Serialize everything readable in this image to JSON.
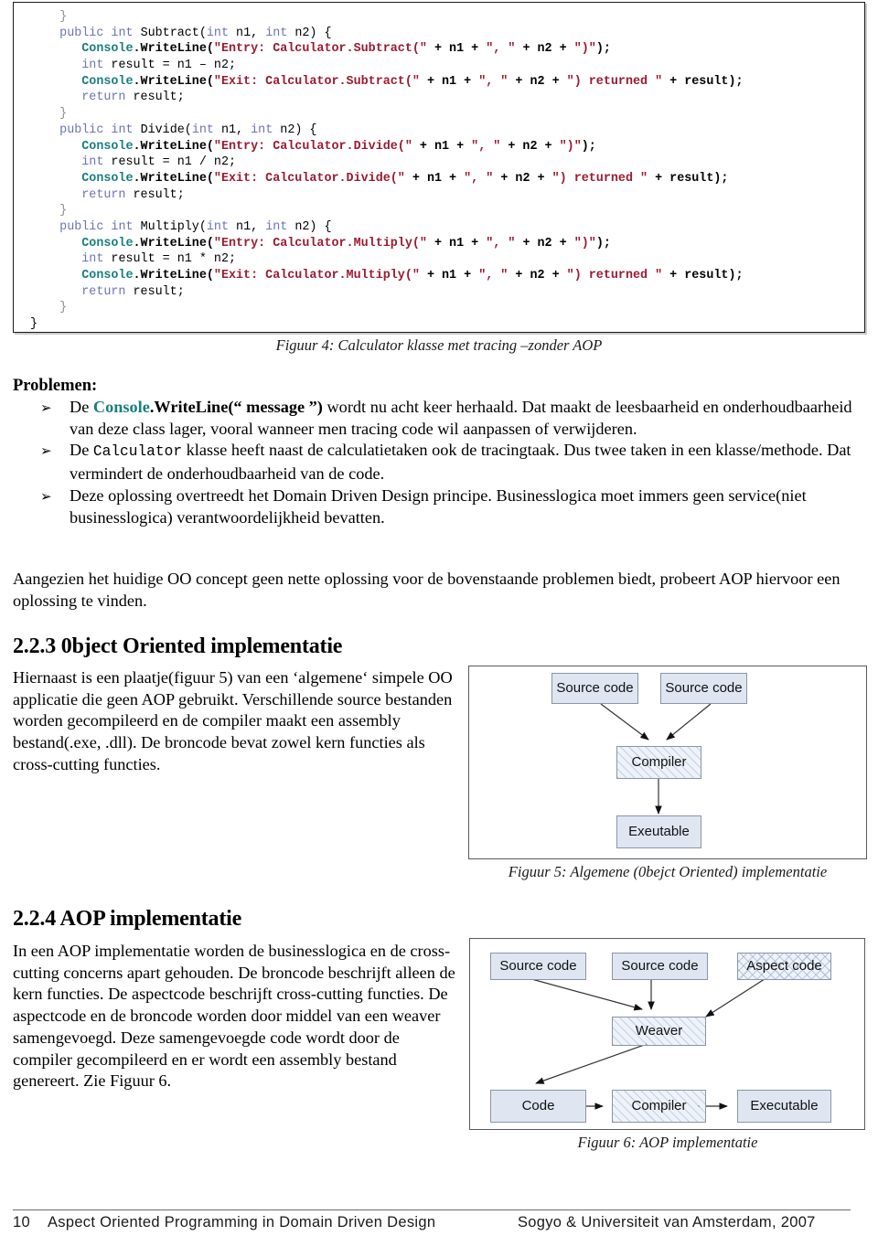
{
  "code_figure": {
    "caption": "Figuur 4: Calculator klasse met tracing –zonder AOP",
    "lines": [
      [
        {
          "t": "    }",
          "c": "gr"
        }
      ],
      [
        {
          "t": "    ",
          "c": "pn"
        },
        {
          "t": "public int ",
          "c": "kw"
        },
        {
          "t": "Subtract(",
          "c": "pl"
        },
        {
          "t": "int ",
          "c": "kw"
        },
        {
          "t": "n1, ",
          "c": "pl"
        },
        {
          "t": "int ",
          "c": "kw"
        },
        {
          "t": "n2) {",
          "c": "pl"
        }
      ],
      [
        {
          "t": "       ",
          "c": "pn"
        },
        {
          "t": "Console",
          "c": "ns"
        },
        {
          "t": ".WriteLine(",
          "c": "mb"
        },
        {
          "t": "\"Entry: Calculator.Subtract(\"",
          "c": "st"
        },
        {
          "t": " + n1 + ",
          "c": "op"
        },
        {
          "t": "\", \"",
          "c": "st"
        },
        {
          "t": " + n2 + ",
          "c": "op"
        },
        {
          "t": "\")\"",
          "c": "st"
        },
        {
          "t": ");",
          "c": "mb"
        }
      ],
      [
        {
          "t": "       ",
          "c": "pn"
        },
        {
          "t": "int ",
          "c": "kw"
        },
        {
          "t": "result = n1 – n2;",
          "c": "pl"
        }
      ],
      [
        {
          "t": "       ",
          "c": "pn"
        },
        {
          "t": "Console",
          "c": "ns"
        },
        {
          "t": ".WriteLine(",
          "c": "mb"
        },
        {
          "t": "\"Exit: Calculator.Subtract(\"",
          "c": "st"
        },
        {
          "t": " + n1 + ",
          "c": "op"
        },
        {
          "t": "\", \"",
          "c": "st"
        },
        {
          "t": " + n2 + ",
          "c": "op"
        },
        {
          "t": "\") returned \"",
          "c": "st"
        },
        {
          "t": " + result);",
          "c": "op"
        }
      ],
      [
        {
          "t": "       ",
          "c": "pn"
        },
        {
          "t": "return ",
          "c": "kw"
        },
        {
          "t": "result;",
          "c": "pl"
        }
      ],
      [
        {
          "t": "    }",
          "c": "gr"
        }
      ],
      [
        {
          "t": "    ",
          "c": "pn"
        },
        {
          "t": "public int ",
          "c": "kw"
        },
        {
          "t": "Divide(",
          "c": "pl"
        },
        {
          "t": "int ",
          "c": "kw"
        },
        {
          "t": "n1, ",
          "c": "pl"
        },
        {
          "t": "int ",
          "c": "kw"
        },
        {
          "t": "n2) {",
          "c": "pl"
        }
      ],
      [
        {
          "t": "       ",
          "c": "pn"
        },
        {
          "t": "Console",
          "c": "ns"
        },
        {
          "t": ".WriteLine(",
          "c": "mb"
        },
        {
          "t": "\"Entry: Calculator.Divide(\"",
          "c": "st"
        },
        {
          "t": " + n1 + ",
          "c": "op"
        },
        {
          "t": "\", \"",
          "c": "st"
        },
        {
          "t": " + n2 + ",
          "c": "op"
        },
        {
          "t": "\")\"",
          "c": "st"
        },
        {
          "t": ");",
          "c": "mb"
        }
      ],
      [
        {
          "t": "       ",
          "c": "pn"
        },
        {
          "t": "int ",
          "c": "kw"
        },
        {
          "t": "result = n1 / n2;",
          "c": "pl"
        }
      ],
      [
        {
          "t": "       ",
          "c": "pn"
        },
        {
          "t": "Console",
          "c": "ns"
        },
        {
          "t": ".WriteLine(",
          "c": "mb"
        },
        {
          "t": "\"Exit: Calculator.Divide(\"",
          "c": "st"
        },
        {
          "t": " + n1 + ",
          "c": "op"
        },
        {
          "t": "\", \"",
          "c": "st"
        },
        {
          "t": " + n2 + ",
          "c": "op"
        },
        {
          "t": "\") returned \"",
          "c": "st"
        },
        {
          "t": " + result);",
          "c": "op"
        }
      ],
      [
        {
          "t": "       ",
          "c": "pn"
        },
        {
          "t": "return ",
          "c": "kw"
        },
        {
          "t": "result;",
          "c": "pl"
        }
      ],
      [
        {
          "t": "    }",
          "c": "gr"
        }
      ],
      [
        {
          "t": "    ",
          "c": "pn"
        },
        {
          "t": "public int ",
          "c": "kw"
        },
        {
          "t": "Multiply(",
          "c": "pl"
        },
        {
          "t": "int ",
          "c": "kw"
        },
        {
          "t": "n1, ",
          "c": "pl"
        },
        {
          "t": "int ",
          "c": "kw"
        },
        {
          "t": "n2) {",
          "c": "pl"
        }
      ],
      [
        {
          "t": "       ",
          "c": "pn"
        },
        {
          "t": "Console",
          "c": "ns"
        },
        {
          "t": ".WriteLine(",
          "c": "mb"
        },
        {
          "t": "\"Entry: Calculator.Multiply(\"",
          "c": "st"
        },
        {
          "t": " + n1 + ",
          "c": "op"
        },
        {
          "t": "\", \"",
          "c": "st"
        },
        {
          "t": " + n2 + ",
          "c": "op"
        },
        {
          "t": "\")\"",
          "c": "st"
        },
        {
          "t": ");",
          "c": "mb"
        }
      ],
      [
        {
          "t": "       ",
          "c": "pn"
        },
        {
          "t": "int ",
          "c": "kw"
        },
        {
          "t": "result = n1 * n2;",
          "c": "pl"
        }
      ],
      [
        {
          "t": "       ",
          "c": "pn"
        },
        {
          "t": "Console",
          "c": "ns"
        },
        {
          "t": ".WriteLine(",
          "c": "mb"
        },
        {
          "t": "\"Exit: Calculator.Multiply(\"",
          "c": "st"
        },
        {
          "t": " + n1 + ",
          "c": "op"
        },
        {
          "t": "\", \"",
          "c": "st"
        },
        {
          "t": " + n2 + ",
          "c": "op"
        },
        {
          "t": "\") returned \"",
          "c": "st"
        },
        {
          "t": " + result);",
          "c": "op"
        }
      ],
      [
        {
          "t": "       ",
          "c": "pn"
        },
        {
          "t": "return ",
          "c": "kw"
        },
        {
          "t": "result;",
          "c": "pl"
        }
      ],
      [
        {
          "t": "    }",
          "c": "gr"
        }
      ],
      [
        {
          "t": "}",
          "c": "pl"
        }
      ]
    ]
  },
  "problemen": {
    "heading": "Problemen:",
    "bullet_glyph": "➢",
    "items": [
      {
        "prefix": "De ",
        "emph_teal": "Console",
        "emph_black": ".WriteLine(“ message ”)",
        "rest": " wordt nu acht keer herhaald. Dat maakt de leesbaarheid en onderhoudbaarheid van deze class lager, vooral wanneer men tracing code wil aanpassen of verwijderen."
      },
      {
        "prefix": "De ",
        "mono": "Calculator",
        "rest": " klasse heeft naast de calculatietaken ook de tracingtaak. Dus twee taken in een klasse/methode. Dat vermindert de onderhoudbaarheid van de code."
      },
      {
        "text": "Deze oplossing overtreedt het Domain Driven Design principe. Businesslogica moet immers geen service(niet businesslogica) verantwoordelijkheid bevatten."
      }
    ]
  },
  "intro_aop": "Aangezien het huidige OO concept geen nette oplossing voor de bovenstaande problemen biedt, probeert AOP hiervoor een oplossing te vinden.",
  "section_223": {
    "heading": "2.2.3 0bject Oriented implementatie",
    "paragraph": "Hiernaast is een plaatje(figuur 5) van een ‘algemene‘ simpele OO applicatie die geen AOP gebruikt. Verschillende source bestanden worden gecompileerd en de compiler maakt een assembly bestand(.exe, .dll). De broncode bevat zowel kern functies als cross-cutting functies."
  },
  "section_224": {
    "heading": "2.2.4 AOP implementatie",
    "paragraph": "In een AOP implementatie worden de businesslogica en de cross-cutting concerns apart gehouden. De broncode beschrijft alleen de kern functies. De aspectcode beschrijft cross-cutting functies. De aspectcode en de broncode worden door middel van een weaver samengevoegd. Deze samengevoegde code wordt door de compiler gecompileerd en  er wordt een assembly bestand genereert. Zie Figuur 6."
  },
  "figure5": {
    "caption": "Figuur 5: Algemene (0bejct Oriented) implementatie",
    "nodes": {
      "source_left": "Source code",
      "source_right": "Source code",
      "compiler": "Compiler",
      "executable": "Exeutable"
    }
  },
  "figure6": {
    "caption": "Figuur 6: AOP implementatie",
    "nodes": {
      "source_left": "Source code",
      "source_mid": "Source code",
      "aspect": "Aspect code",
      "weaver": "Weaver",
      "code": "Code",
      "compiler": "Compiler",
      "executable": "Executable"
    }
  },
  "footer": {
    "page": "10",
    "title": "Aspect Oriented Programming in Domain Driven Design",
    "org": "Sogyo & Universiteit van Amsterdam, 2007"
  },
  "colors": {
    "keyword": "#6a74b8",
    "namespace_teal": "#1a7f7f",
    "string_red": "#9b1b30",
    "box_fill": "#dfe6f2",
    "box_border": "#8a95a5",
    "frame_border": "#555a5f"
  }
}
